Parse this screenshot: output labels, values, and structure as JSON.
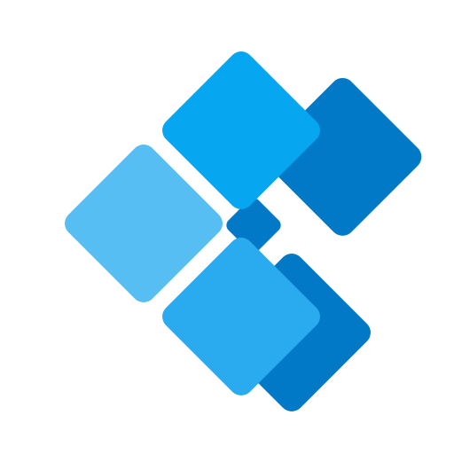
{
  "icon": {
    "name": "power-automate-logo",
    "colors": {
      "top_tile": "#06A6F0",
      "middle_tile": "#57BEF4",
      "bottom_tile": "#2AAAEF",
      "shadow_tiles": "#0279C6",
      "background": "#FFFFFF"
    }
  }
}
